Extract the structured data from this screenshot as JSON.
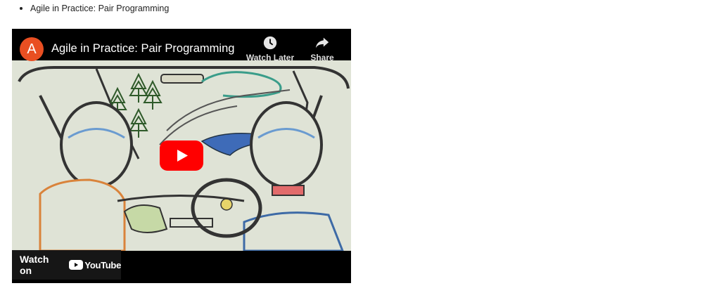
{
  "list": {
    "items": [
      {
        "label": "Agile in Practice: Pair Programming"
      }
    ]
  },
  "video": {
    "channel_initial": "A",
    "title": "Agile in Practice: Pair Programming",
    "watch_later_label": "Watch Later",
    "share_label": "Share",
    "watch_on_label": "Watch on",
    "youtube_wordmark": "YouTube",
    "icons": {
      "watch_later": "clock-icon",
      "share": "share-arrow-icon",
      "play": "play-button-icon",
      "youtube": "youtube-logo-icon"
    },
    "colors": {
      "avatar": "#e94f22",
      "play": "#ff0000"
    }
  }
}
